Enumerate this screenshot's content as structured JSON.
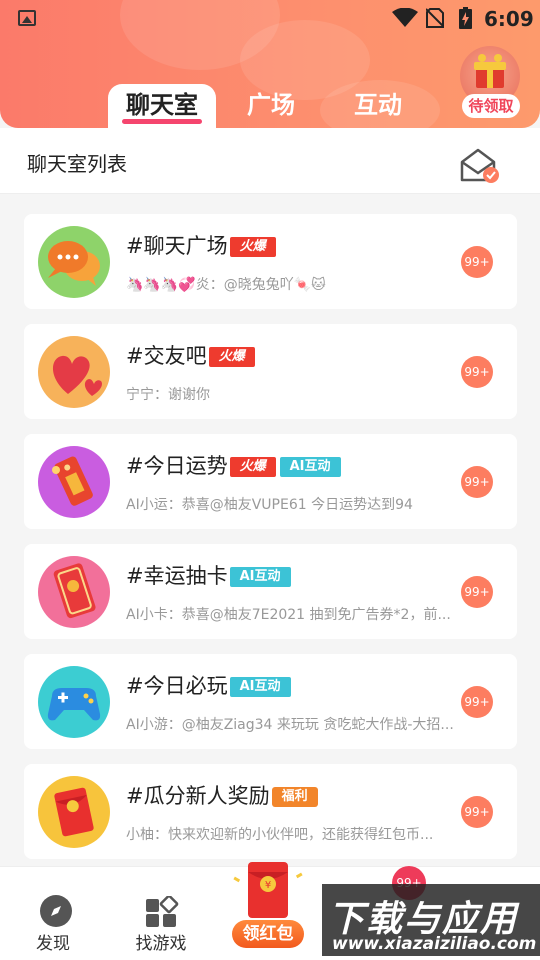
{
  "status_bar": {
    "time": "6:09"
  },
  "header": {
    "tabs": [
      {
        "label": "聊天室",
        "active": true
      },
      {
        "label": "广场",
        "active": false
      },
      {
        "label": "互动",
        "active": false
      }
    ],
    "reward_badge": "待领取",
    "accent_color": "#fd8e6e"
  },
  "section": {
    "title": "聊天室列表"
  },
  "rooms": [
    {
      "name": "#聊天广场",
      "tags": [
        "火爆"
      ],
      "last_message": "🦄🦄🦄💞炎：@晓兔兔吖🍬🐱",
      "unread": "99+"
    },
    {
      "name": "#交友吧",
      "tags": [
        "火爆"
      ],
      "last_message": "宁宁：谢谢你",
      "unread": "99+"
    },
    {
      "name": "#今日运势",
      "tags": [
        "火爆",
        "AI互动"
      ],
      "last_message": "AI小运：恭喜@柚友VUPE61 今日运势达到94",
      "unread": "99+"
    },
    {
      "name": "#幸运抽卡",
      "tags": [
        "AI互动"
      ],
      "last_message": "AI小卡：恭喜@柚友7E2021 抽到免广告券*2，前...",
      "unread": "99+"
    },
    {
      "name": "#今日必玩",
      "tags": [
        "AI互动"
      ],
      "last_message": "AI小游：@柚友Ziag34 来玩玩 贪吃蛇大作战-大招...",
      "unread": "99+"
    },
    {
      "name": "#瓜分新人奖励",
      "tags": [
        "福利"
      ],
      "last_message": "小柚：快来欢迎新的小伙伴吧，还能获得红包币...",
      "unread": "99+"
    }
  ],
  "bottom_nav": {
    "discover": "发现",
    "games": "找游戏",
    "red_packet": "领红包",
    "badge": "99+",
    "watermark_title": "下载与应用",
    "watermark_url": "www.xiazaiziliao.com"
  }
}
